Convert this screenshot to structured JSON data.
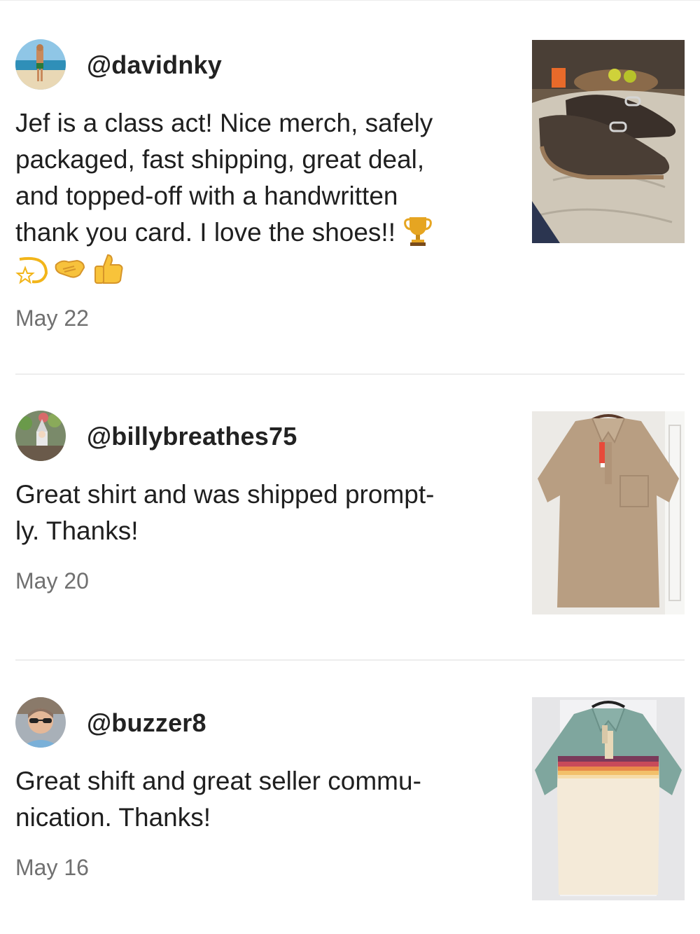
{
  "reviews": [
    {
      "username": "@davidnky",
      "text": "Jef is a class act! Nice merch, safely\npackaged, fast shipping, great deal,\nand topped-off with a handwritten\nthank you card. I love the shoes!!",
      "emojis": [
        "trophy-emoji",
        "dizzy-star-emoji",
        "handshake-emoji",
        "thumbs-up-emoji"
      ],
      "date": "May 22",
      "photo": "loafers-photo"
    },
    {
      "username": "@billybreathes75",
      "text": "Great shirt and was shipped prompt-\nly. Thanks!",
      "date": "May 20",
      "photo": "tan-polo-shirt-photo"
    },
    {
      "username": "@buzzer8",
      "text": "Great shift and great seller commu-\nnication. Thanks!",
      "date": "May 16",
      "photo": "striped-polo-shirt-photo"
    }
  ],
  "colors": {
    "date": "#707070",
    "divider": "#ededed",
    "text": "#1f1f1f"
  }
}
